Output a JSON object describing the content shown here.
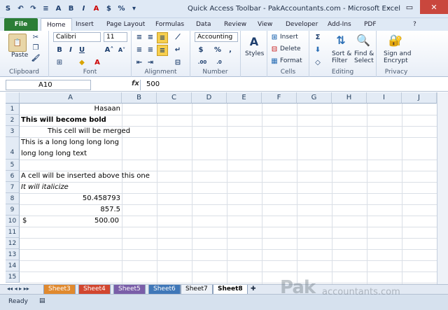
{
  "window": {
    "title": "Quick Access Toolbar - PakAccountants.com - Microsoft Excel"
  },
  "qat": [
    "S",
    "↶",
    "↷",
    "≡",
    "A",
    "B",
    "I",
    "A",
    "$",
    "%",
    "▾"
  ],
  "tabs": [
    "File",
    "Home",
    "Insert",
    "Page Layout",
    "Formulas",
    "Data",
    "Review",
    "View",
    "Developer",
    "Add-Ins",
    "PDF"
  ],
  "ribbon": {
    "clipboard": {
      "label": "Clipboard",
      "paste": "Paste"
    },
    "font": {
      "label": "Font",
      "name": "Calibri",
      "size": "11"
    },
    "alignment": {
      "label": "Alignment"
    },
    "number": {
      "label": "Number",
      "format": "Accounting"
    },
    "styles": {
      "label": "Styles"
    },
    "cells": {
      "label": "Cells",
      "insert": "Insert",
      "delete": "Delete",
      "format": "Format"
    },
    "editing": {
      "label": "Editing",
      "sort": "Sort &",
      "filter": "Filter",
      "find": "Find &",
      "select": "Select"
    },
    "privacy": {
      "label": "Privacy",
      "sign": "Sign and",
      "encrypt": "Encrypt"
    }
  },
  "formula_bar": {
    "name_box": "A10",
    "fx": "fx",
    "value": "500"
  },
  "columns": [
    "A",
    "B",
    "C",
    "D",
    "E",
    "F",
    "G",
    "H",
    "I",
    "J"
  ],
  "rows": [
    "1",
    "2",
    "3",
    "4",
    "5",
    "6",
    "7",
    "8",
    "9",
    "10",
    "11",
    "12",
    "13",
    "14",
    "15"
  ],
  "cells": {
    "a1": "Hasaan",
    "a2": "This will become bold",
    "a3": "This cell will be merged",
    "a4_line1": "This is a long long long long",
    "a4_line2": "long long long text",
    "a6": "A cell will be inserted above this one",
    "a7": "It will italicize",
    "a8": "50.458793",
    "a9": "857.5",
    "a10_symbol": "$",
    "a10_value": "500.00"
  },
  "sheets": [
    "Sheet3",
    "Sheet4",
    "Sheet5",
    "Sheet6",
    "Sheet7",
    "Sheet8"
  ],
  "status": {
    "mode": "Ready"
  },
  "watermark": {
    "big": "Pak",
    "small": "accountants.com"
  }
}
